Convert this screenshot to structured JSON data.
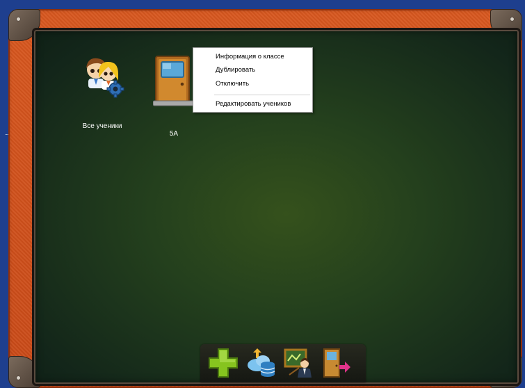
{
  "side_dots": "...",
  "tiles": [
    {
      "label": "Все ученики",
      "icon": "students-settings-icon"
    },
    {
      "label": "5А",
      "icon": "classroom-door-icon"
    }
  ],
  "context_menu": {
    "items": [
      "Информация о классе",
      "Дублировать",
      "Отключить",
      "Редактировать учеников"
    ]
  },
  "toolbar": {
    "buttons": [
      {
        "name": "add-icon",
        "color": "#86c41f"
      },
      {
        "name": "cloud-database-icon",
        "color": "#4aa3e0"
      },
      {
        "name": "teacher-board-icon",
        "color": "#c0d86a"
      },
      {
        "name": "exit-door-icon",
        "color": "#e0338a"
      }
    ]
  },
  "colors": {
    "frame": "#c94a18",
    "board": "#24401d",
    "background": "#1e3f8e"
  }
}
